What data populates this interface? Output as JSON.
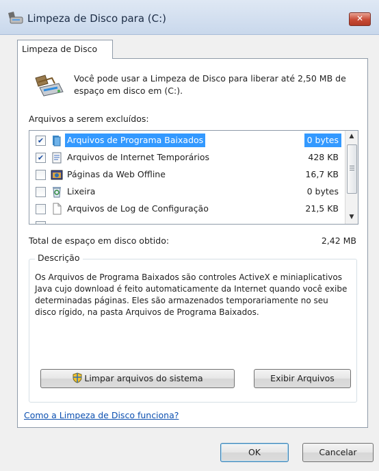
{
  "window": {
    "title": "Limpeza de Disco para  (C:)",
    "close_label": "✕"
  },
  "tab": {
    "label": "Limpeza de Disco"
  },
  "intro": {
    "text": "Você pode usar a Limpeza de Disco para liberar até 2,50 MB de espaço em disco em  (C:)."
  },
  "files": {
    "label": "Arquivos a serem excluídos:",
    "items": [
      {
        "name": "Arquivos de Programa Baixados",
        "size": "0 bytes",
        "checked": true,
        "selected": true,
        "icon": "folder-icon"
      },
      {
        "name": "Arquivos de Internet Temporários",
        "size": "428 KB",
        "checked": true,
        "selected": false,
        "icon": "document-icon"
      },
      {
        "name": "Páginas da Web Offline",
        "size": "16,7 KB",
        "checked": false,
        "selected": false,
        "icon": "web-page-icon"
      },
      {
        "name": "Lixeira",
        "size": "0 bytes",
        "checked": false,
        "selected": false,
        "icon": "recycle-bin-icon"
      },
      {
        "name": "Arquivos de Log de Configuração",
        "size": "21,5 KB",
        "checked": false,
        "selected": false,
        "icon": "blank-file-icon"
      }
    ]
  },
  "total": {
    "label": "Total de espaço em disco obtido:",
    "value": "2,42 MB"
  },
  "description": {
    "legend": "Descrição",
    "text": "Os Arquivos de Programa Baixados são controles ActiveX e miniaplicativos Java cujo download é feito automaticamente da Internet quando você exibe determinadas páginas. Eles são armazenados temporariamente no seu disco rígido, na pasta Arquivos de Programa Baixados."
  },
  "buttons": {
    "clean_system": "Limpar arquivos do sistema",
    "view_files": "Exibir Arquivos",
    "ok": "OK",
    "cancel": "Cancelar"
  },
  "help_link": "Como a Limpeza de Disco funciona?",
  "colors": {
    "selection": "#3399ff",
    "link": "#0b4fb0",
    "close": "#c84a35"
  }
}
